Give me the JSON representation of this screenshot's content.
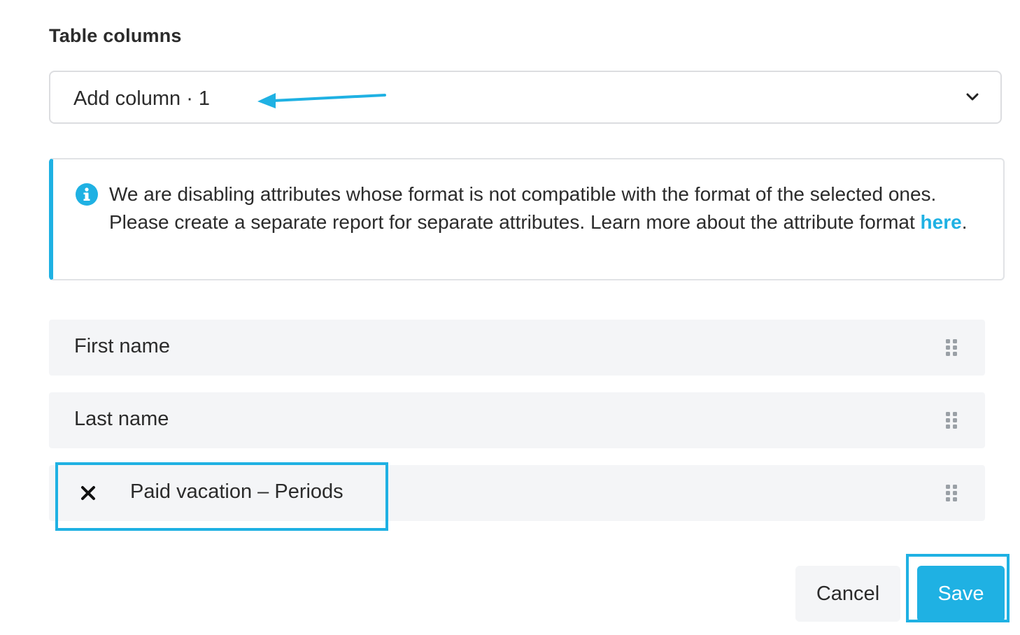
{
  "section": {
    "title": "Table columns"
  },
  "add_column": {
    "label": "Add column · 1"
  },
  "info": {
    "text_before_link": "We are disabling attributes whose format is not compatible with the format of the selected ones. Please create a separate report for separate attributes. Learn more about the attribute format ",
    "link_text": "here",
    "text_after_link": "."
  },
  "columns": [
    {
      "label": "First name"
    },
    {
      "label": "Last name"
    },
    {
      "label": "Paid vacation – Periods"
    }
  ],
  "actions": {
    "cancel_label": "Cancel",
    "save_label": "Save"
  },
  "colors": {
    "accent": "#1fb1e3",
    "row_background": "#f4f5f7",
    "text": "#2b2b2b"
  },
  "icons": {
    "dropdown": "chevron-down-icon",
    "info": "info-icon",
    "drag": "drag-handle-icon",
    "remove": "close-icon"
  }
}
